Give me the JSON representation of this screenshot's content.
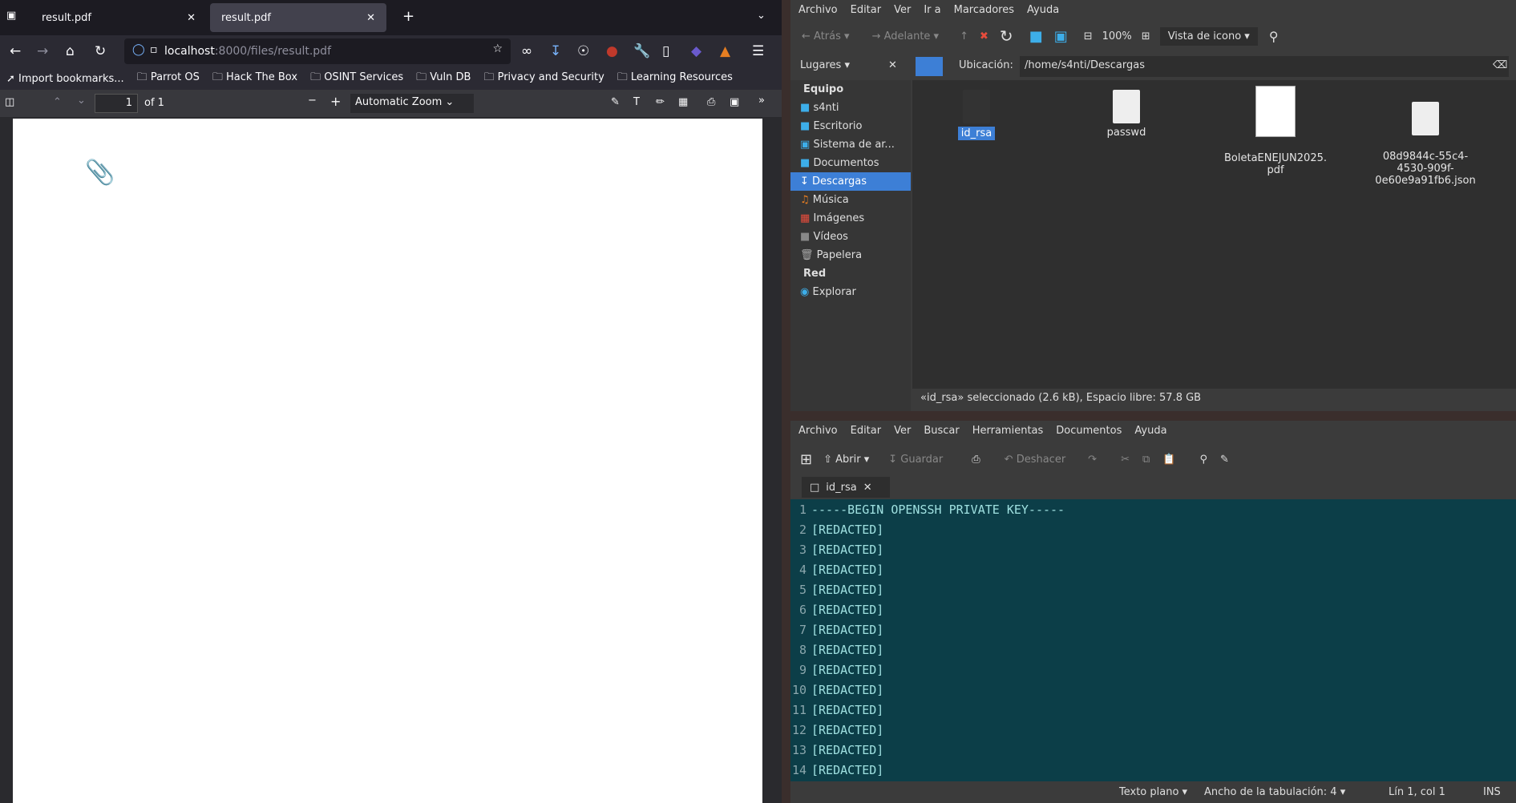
{
  "firefox": {
    "tabs": [
      {
        "title": "result.pdf"
      },
      {
        "title": "result.pdf"
      }
    ],
    "url_host": "localhost",
    "url_path": ":8000/files/result.pdf",
    "bookmarks": [
      "Import bookmarks...",
      "Parrot OS",
      "Hack The Box",
      "OSINT Services",
      "Vuln DB",
      "Privacy and Security",
      "Learning Resources"
    ],
    "pdf": {
      "page": "1",
      "of": "of 1",
      "zoom": "Automatic Zoom"
    }
  },
  "filemanager": {
    "menu": [
      "Archivo",
      "Editar",
      "Ver",
      "Ir a",
      "Marcadores",
      "Ayuda"
    ],
    "back": "Atrás",
    "forward": "Adelante",
    "zoom": "100%",
    "view": "Vista de icono",
    "places_label": "Lugares",
    "location_label": "Ubicación:",
    "location": "/home/s4nti/Descargas",
    "sidebar": {
      "equipo": "Equipo",
      "items": [
        "s4nti",
        "Escritorio",
        "Sistema de ar...",
        "Documentos",
        "Descargas",
        "Música",
        "Imágenes",
        "Vídeos",
        "Papelera"
      ],
      "red": "Red",
      "red_items": [
        "Explorar"
      ]
    },
    "files": [
      {
        "name": "id_rsa"
      },
      {
        "name": "passwd"
      },
      {
        "name": "BoletaENEJUN2025.\npdf"
      },
      {
        "name": "08d9844c-55c4-\n4530-909f-\n0e60e9a91fb6.json"
      }
    ],
    "status": "«id_rsa» seleccionado (2.6 kB), Espacio libre: 57.8 GB"
  },
  "gedit": {
    "menu": [
      "Archivo",
      "Editar",
      "Ver",
      "Buscar",
      "Herramientas",
      "Documentos",
      "Ayuda"
    ],
    "open": "Abrir",
    "save": "Guardar",
    "undo": "Deshacer",
    "tab": "id_rsa",
    "lines": [
      "-----BEGIN OPENSSH PRIVATE KEY-----",
      "[REDACTED]",
      "[REDACTED]",
      "[REDACTED]",
      "[REDACTED]",
      "[REDACTED]",
      "[REDACTED]",
      "[REDACTED]",
      "[REDACTED]",
      "[REDACTED]",
      "[REDACTED]",
      "[REDACTED]",
      "[REDACTED]",
      "[REDACTED]"
    ],
    "status": {
      "syntax": "Texto plano",
      "tab_width": "Ancho de la tabulación: 4",
      "position": "Lín 1, col 1",
      "mode": "INS"
    }
  }
}
